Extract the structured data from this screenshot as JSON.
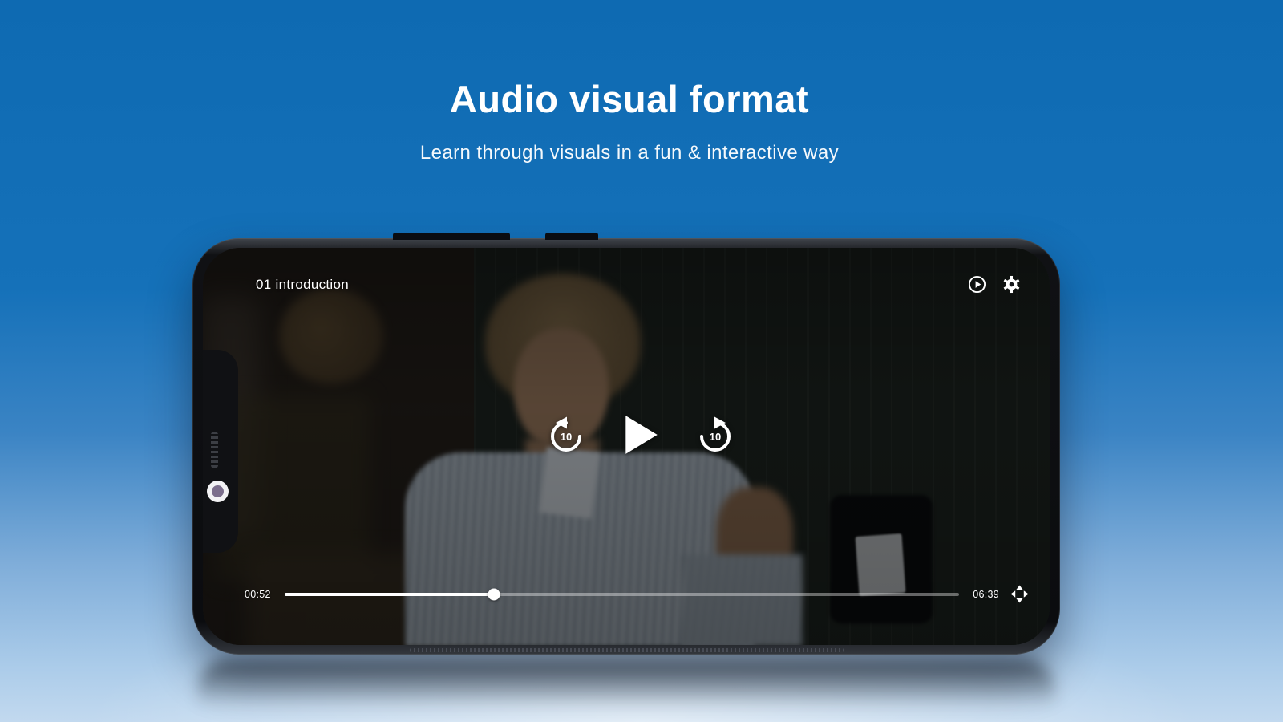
{
  "hero": {
    "title": "Audio visual format",
    "subtitle": "Learn through visuals in a fun & interactive way"
  },
  "player": {
    "video_title": "01 introduction",
    "current_time": "00:52",
    "duration": "06:39",
    "progress_percent": 31,
    "skip_back_label": "10",
    "skip_forward_label": "10",
    "icons": {
      "top_right": [
        "playback-speed-icon",
        "settings-gear-icon"
      ],
      "center": [
        "rewind-10-icon",
        "play-icon",
        "forward-10-icon"
      ],
      "bottom_right": "fullscreen-move-icon"
    }
  },
  "colors": {
    "background_top": "#0e6ab2",
    "background_bottom": "#c2d9ef",
    "text": "#ffffff",
    "phone_frame": "#0b0c0f",
    "progress_track": "rgba(255,255,255,0.38)",
    "progress_played": "#ffffff"
  }
}
